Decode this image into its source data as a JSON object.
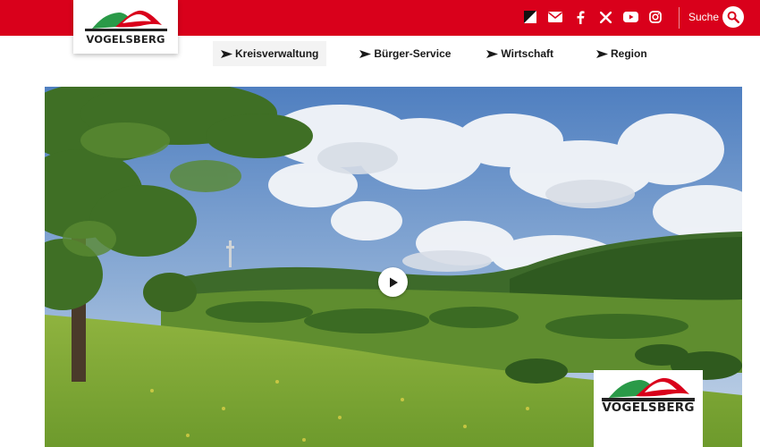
{
  "brand": {
    "name": "VOGELSBERG",
    "color_primary": "#d9001b",
    "color_green": "#2a9a48"
  },
  "header": {
    "icons": [
      {
        "name": "contrast-icon"
      },
      {
        "name": "email-icon"
      },
      {
        "name": "facebook-icon"
      },
      {
        "name": "x-icon"
      },
      {
        "name": "youtube-icon"
      },
      {
        "name": "instagram-icon"
      }
    ],
    "search_label": "Suche"
  },
  "nav": {
    "items": [
      {
        "label": "Kreisverwaltung"
      },
      {
        "label": "Bürger-Service"
      },
      {
        "label": "Wirtschaft"
      },
      {
        "label": "Region"
      }
    ]
  },
  "hero": {
    "play_icon": "play-icon"
  },
  "badge": {
    "name": "VOGELSBERG"
  }
}
